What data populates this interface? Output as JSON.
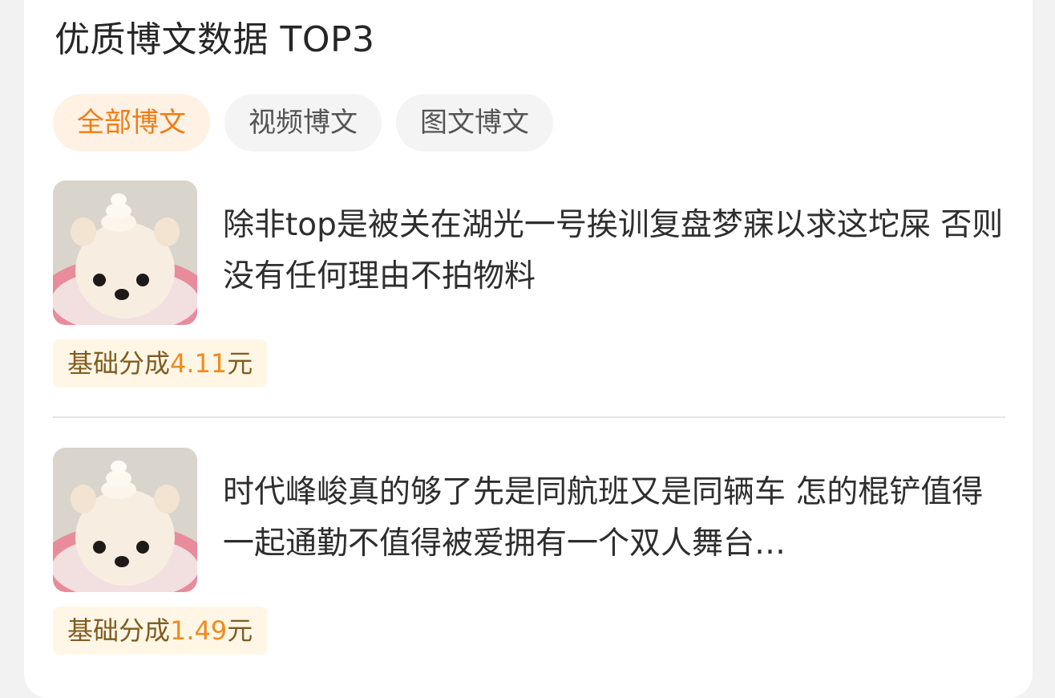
{
  "section": {
    "title": "优质博文数据 TOP3"
  },
  "tabs": [
    {
      "label": "全部博文",
      "active": true
    },
    {
      "label": "视频博文",
      "active": false
    },
    {
      "label": "图文博文",
      "active": false
    }
  ],
  "posts": [
    {
      "thumbnail": "pomeranian-dog-photo",
      "text": "除非top是被关在湖光一号挨训复盘梦寐以求这坨屎 否则没有任何理由不拍物料",
      "earnings_label": "基础分成",
      "earnings_amount": "4.11",
      "earnings_unit": "元"
    },
    {
      "thumbnail": "pomeranian-dog-photo",
      "text": "时代峰峻真的够了先是同航班又是同辆车 怎的棍铲值得一起通勤不值得被爱拥有一个双人舞台…",
      "earnings_label": "基础分成",
      "earnings_amount": "1.49",
      "earnings_unit": "元"
    }
  ],
  "colors": {
    "accent": "#f07d13",
    "badge_bg": "#fff6e6",
    "tab_active_bg": "#fff1e4"
  }
}
